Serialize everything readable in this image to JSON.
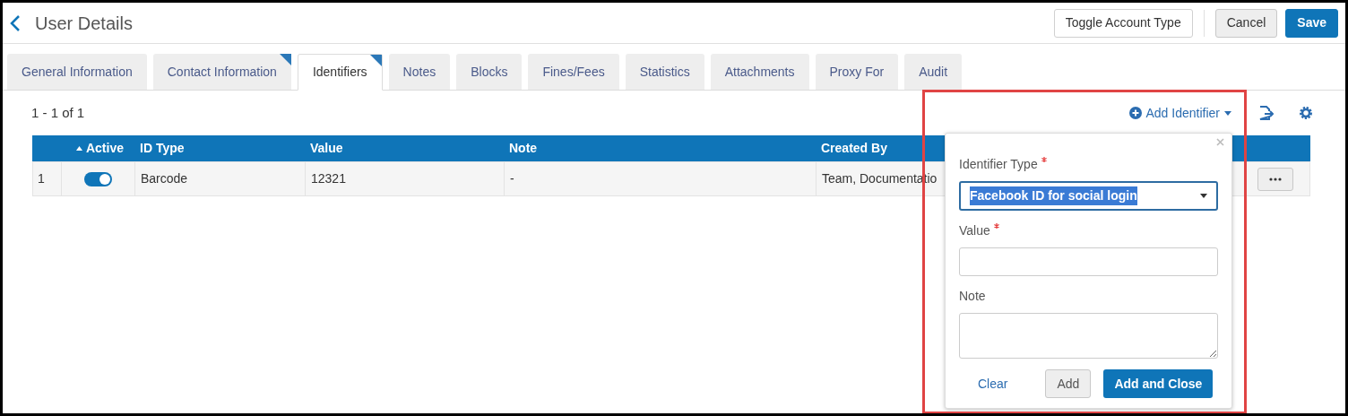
{
  "header": {
    "title": "User Details",
    "buttons": [
      {
        "label": "Toggle Account Type",
        "kind": "outline"
      },
      {
        "label": "Cancel",
        "kind": "grey"
      },
      {
        "label": "Save",
        "kind": "primary"
      }
    ]
  },
  "tabs": [
    {
      "label": "General Information",
      "selected": false,
      "flagged": false
    },
    {
      "label": "Contact Information",
      "selected": false,
      "flagged": true
    },
    {
      "label": "Identifiers",
      "selected": true,
      "flagged": true
    },
    {
      "label": "Notes",
      "selected": false,
      "flagged": false
    },
    {
      "label": "Blocks",
      "selected": false,
      "flagged": false
    },
    {
      "label": "Fines/Fees",
      "selected": false,
      "flagged": false
    },
    {
      "label": "Statistics",
      "selected": false,
      "flagged": false
    },
    {
      "label": "Attachments",
      "selected": false,
      "flagged": false
    },
    {
      "label": "Proxy For",
      "selected": false,
      "flagged": false
    },
    {
      "label": "Audit",
      "selected": false,
      "flagged": false
    }
  ],
  "toolbar": {
    "count": "1 - 1 of 1",
    "add_button": "Add Identifier"
  },
  "table": {
    "columns": [
      "Active",
      "ID Type",
      "Value",
      "Note",
      "Created By"
    ],
    "rows": [
      {
        "index": "1",
        "active": true,
        "id_type": "Barcode",
        "value": "12321",
        "note": "-",
        "created_by": "Team, Documentatio"
      }
    ]
  },
  "popup": {
    "fields": [
      {
        "label": "Identifier Type",
        "required": true,
        "kind": "select",
        "value": "Facebook ID for social login"
      },
      {
        "label": "Value",
        "required": true,
        "kind": "input"
      },
      {
        "label": "Note",
        "required": false,
        "kind": "textarea"
      }
    ],
    "clear": "Clear",
    "add": "Add",
    "add_close": "Add and Close"
  }
}
